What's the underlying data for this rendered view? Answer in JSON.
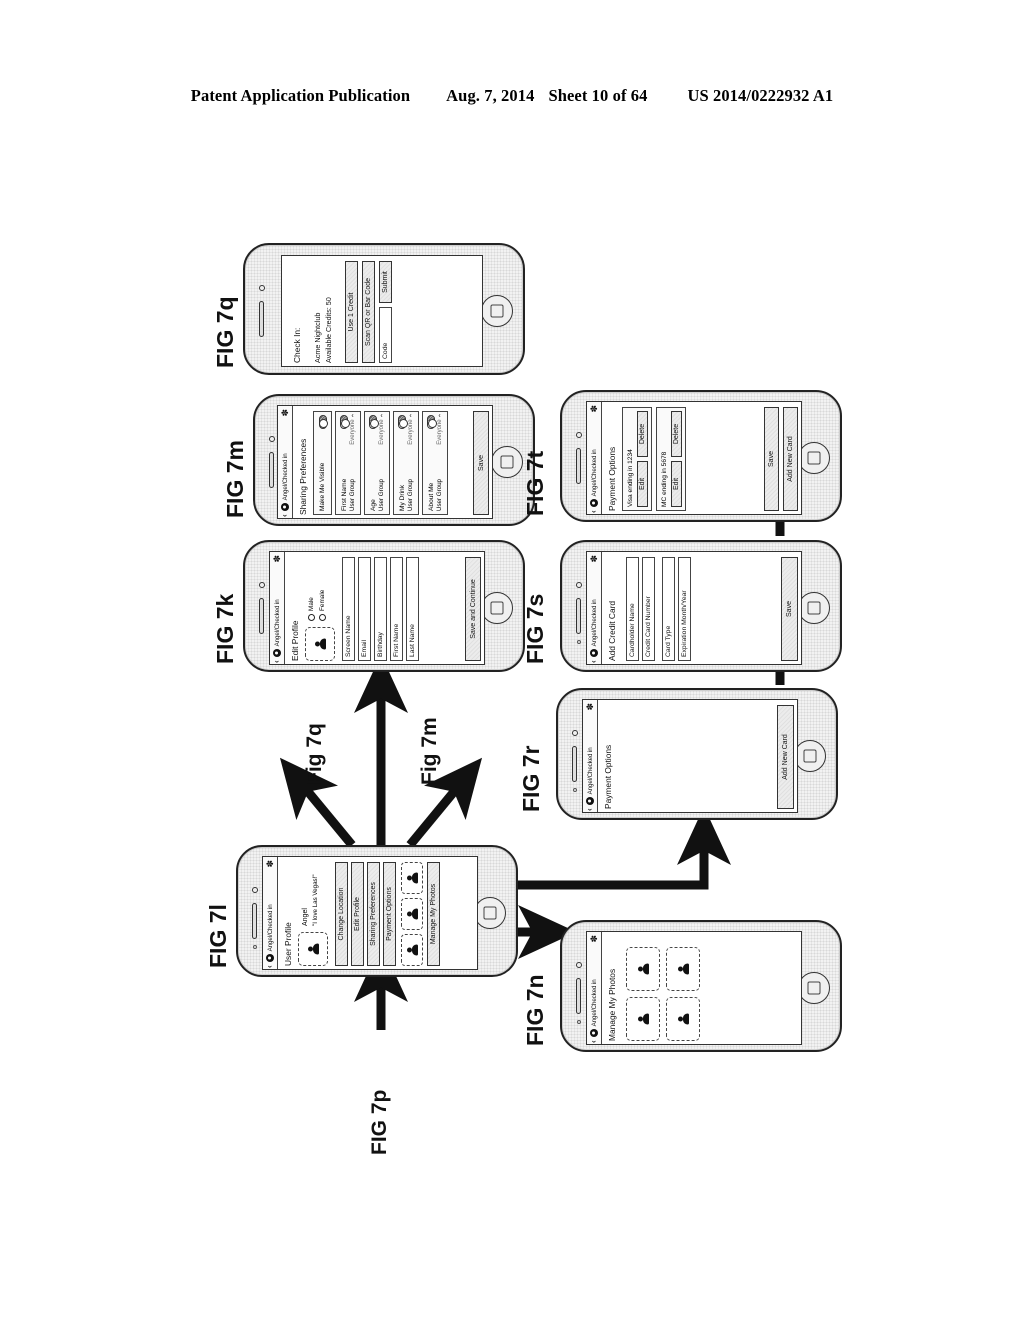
{
  "header": {
    "left": "Patent Application Publication",
    "date": "Aug. 7, 2014",
    "sheet": "Sheet 10 of 64",
    "pubno": "US 2014/0222932 A1"
  },
  "nav": {
    "back": "‹",
    "title": "Angel/Checked in",
    "gear": "✽"
  },
  "figures": {
    "fig7q": "FIG 7q",
    "fig7m": "FIG 7m",
    "fig7k": "FIG 7k",
    "fig7l": "FIG 7l",
    "fig7t": "FIG 7t",
    "fig7s": "FIG 7s",
    "fig7r": "FIG 7r",
    "fig7n": "FIG 7n"
  },
  "arrow_labels": {
    "to_7q": "Fig 7q",
    "to_7m": "Fig 7m",
    "from_7p": "FIG 7p"
  },
  "screens": {
    "checkin": {
      "title": "Check In:",
      "venue": "Acme Nightclub",
      "credits": "Available Credits: 50",
      "use_credit": "Use 1 Credit",
      "scan": "Scan QR or Bar Code",
      "code_placeholder": "Code",
      "submit": "Submit"
    },
    "sharing": {
      "title": "Sharing Preferences",
      "rows": [
        {
          "label": "Make Me Visible",
          "sub": "",
          "value": ""
        },
        {
          "label": "First Name",
          "sub": "User Group",
          "value": "Everyone"
        },
        {
          "label": "Age",
          "sub": "User Group",
          "value": "Everyone"
        },
        {
          "label": "My Drink",
          "sub": "User Group",
          "value": "Everyone"
        },
        {
          "label": "About Me",
          "sub": "User Group",
          "value": "Everyone"
        }
      ],
      "save": "Save"
    },
    "edit_profile": {
      "title": "Edit Profile",
      "gender_male": "Male",
      "gender_female": "Female",
      "fields": [
        "Screen Name",
        "Email",
        "Birthday",
        "First Name",
        "Last Name"
      ],
      "save": "Save and Continue"
    },
    "user_profile": {
      "title": "User Profile",
      "name": "Angel",
      "quote": "\"I love Las Vegas!\"",
      "buttons": [
        "Change Location",
        "Edit Profile",
        "Sharing Preferences",
        "Payment Options"
      ],
      "manage_photos": "Manage My Photos"
    },
    "payment_list": {
      "title": "Payment Options",
      "cards": [
        {
          "label": "Visa ending in 1234",
          "edit": "Edit",
          "delete": "Delete"
        },
        {
          "label": "MC ending in 5678",
          "edit": "Edit",
          "delete": "Delete"
        }
      ],
      "save": "Save",
      "add": "Add New Card"
    },
    "add_card": {
      "title": "Add Credit Card",
      "fields": [
        "Cardholder Name",
        "Credit Card Number",
        "Card Type",
        "Expiration Month/Year"
      ],
      "save": "Save"
    },
    "payment_empty": {
      "title": "Payment Options",
      "add": "Add New Card"
    },
    "manage_photos": {
      "title": "Manage My Photos"
    }
  }
}
